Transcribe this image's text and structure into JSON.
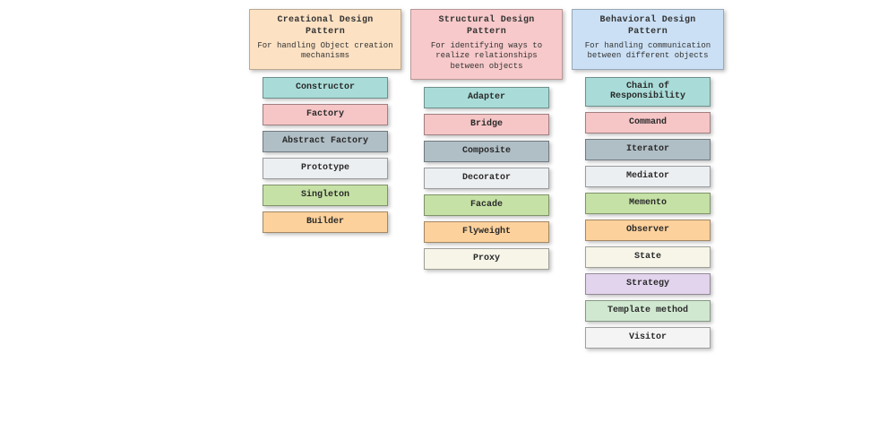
{
  "columns": [
    {
      "key": "creational",
      "header": {
        "title": "Creational Design Pattern",
        "desc": "For handling Object creation mechanisms"
      },
      "headerClass": "hdr-cre",
      "items": [
        {
          "label": "Constructor",
          "color": "c-teal"
        },
        {
          "label": "Factory",
          "color": "c-pink"
        },
        {
          "label": "Abstract Factory",
          "color": "c-slate"
        },
        {
          "label": "Prototype",
          "color": "c-grey"
        },
        {
          "label": "Singleton",
          "color": "c-lime"
        },
        {
          "label": "Builder",
          "color": "c-orange"
        }
      ]
    },
    {
      "key": "structural",
      "header": {
        "title": "Structural Design Pattern",
        "desc": "For identifying ways to realize relationships between objects"
      },
      "headerClass": "hdr-str",
      "items": [
        {
          "label": "Adapter",
          "color": "c-teal"
        },
        {
          "label": "Bridge",
          "color": "c-pink"
        },
        {
          "label": "Composite",
          "color": "c-slate"
        },
        {
          "label": "Decorator",
          "color": "c-grey"
        },
        {
          "label": "Facade",
          "color": "c-lime"
        },
        {
          "label": "Flyweight",
          "color": "c-orange"
        },
        {
          "label": "Proxy",
          "color": "c-cream"
        }
      ]
    },
    {
      "key": "behavioral",
      "header": {
        "title": "Behavioral Design Pattern",
        "desc": "For handling communication between different objects"
      },
      "headerClass": "hdr-beh",
      "items": [
        {
          "label": "Chain of Responsibility",
          "color": "c-teal"
        },
        {
          "label": "Command",
          "color": "c-pink"
        },
        {
          "label": "Iterator",
          "color": "c-slate"
        },
        {
          "label": "Mediator",
          "color": "c-grey"
        },
        {
          "label": "Memento",
          "color": "c-lime"
        },
        {
          "label": "Observer",
          "color": "c-orange"
        },
        {
          "label": "State",
          "color": "c-cream"
        },
        {
          "label": "Strategy",
          "color": "c-lav"
        },
        {
          "label": "Template method",
          "color": "c-mint"
        },
        {
          "label": "Visitor",
          "color": "c-off"
        }
      ]
    }
  ]
}
